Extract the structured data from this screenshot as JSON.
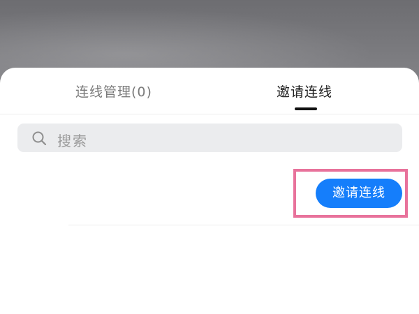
{
  "tabs": [
    {
      "label": "连线管理(0)",
      "active": false
    },
    {
      "label": "邀请连线",
      "active": true
    }
  ],
  "search": {
    "placeholder": "搜索",
    "icon": "search-icon"
  },
  "invite_row": {
    "button_label": "邀请连线"
  },
  "colors": {
    "accent": "#157efb",
    "highlight": "#e8729b",
    "tab_active": "#1b1b1b",
    "tab_inactive": "#7a7a7a",
    "search_bg": "#ebecee"
  }
}
